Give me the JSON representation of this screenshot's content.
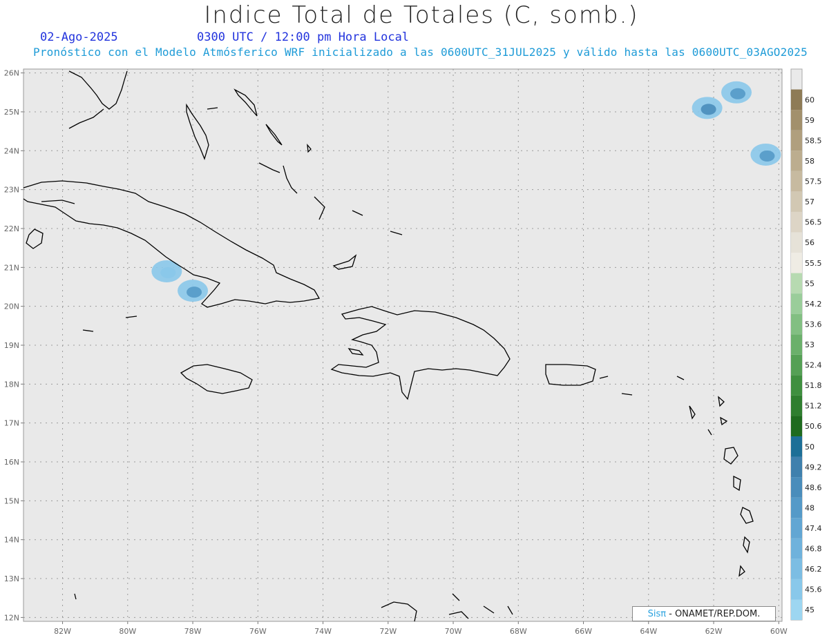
{
  "title": "Indice Total de Totales (C, somb.)",
  "date": "02-Ago-2025",
  "time": "0300 UTC / 12:00 pm Hora Local",
  "subtitle": "Pronóstico con el Modelo Atmósferico WRF inicializado a las 0600UTC_31JUL2025 y válido hasta las  0600UTC_03AGO2025",
  "credit": {
    "brand": "Sisπ",
    "rest": "- ONAMET/REP.DOM."
  },
  "map": {
    "lon_range": [
      -83.2,
      -59.9
    ],
    "lat_range": [
      11.9,
      26.1
    ],
    "lon_ticks": [
      "82W",
      "80W",
      "78W",
      "76W",
      "74W",
      "72W",
      "70W",
      "68W",
      "66W",
      "64W",
      "62W",
      "60W"
    ],
    "lat_ticks": [
      "12N",
      "13N",
      "14N",
      "15N",
      "16N",
      "17N",
      "18N",
      "19N",
      "20N",
      "21N",
      "22N",
      "23N",
      "24N",
      "25N",
      "26N"
    ],
    "background": "#e9e9e9",
    "grid": true
  },
  "colorbar": {
    "labels": [
      "45",
      "45.6",
      "46.2",
      "46.8",
      "47.4",
      "48",
      "48.6",
      "49.2",
      "50",
      "50.6",
      "51.2",
      "51.8",
      "52.4",
      "53",
      "53.6",
      "54.2",
      "55",
      "55.5",
      "56",
      "56.5",
      "57",
      "57.5",
      "58",
      "58.5",
      "59",
      "60"
    ],
    "colors": [
      "#9dd6f1",
      "#89c8ea",
      "#7cbde3",
      "#6fb2dc",
      "#62a6d3",
      "#559ac8",
      "#4a8dbb",
      "#3f80ad",
      "#1d6f97",
      "#1f6b1f",
      "#2f7e2f",
      "#3f8f3f",
      "#55a055",
      "#6bb06b",
      "#82bf82",
      "#9acd9a",
      "#b7dab1",
      "#efece4",
      "#e6e2d8",
      "#ddd5c6",
      "#d2c8b3",
      "#c7baa0",
      "#bcad8f",
      "#b09f7e",
      "#a2906c",
      "#8e7b56"
    ]
  },
  "shading_areas": [
    {
      "lon": -78.8,
      "lat": 20.9,
      "intensity": 46
    },
    {
      "lon": -78.0,
      "lat": 20.4,
      "intensity": 48
    },
    {
      "lon": -62.2,
      "lat": 25.1,
      "intensity": 49
    },
    {
      "lon": -61.3,
      "lat": 25.5,
      "intensity": 48
    },
    {
      "lon": -60.4,
      "lat": 23.9,
      "intensity": 48
    }
  ]
}
